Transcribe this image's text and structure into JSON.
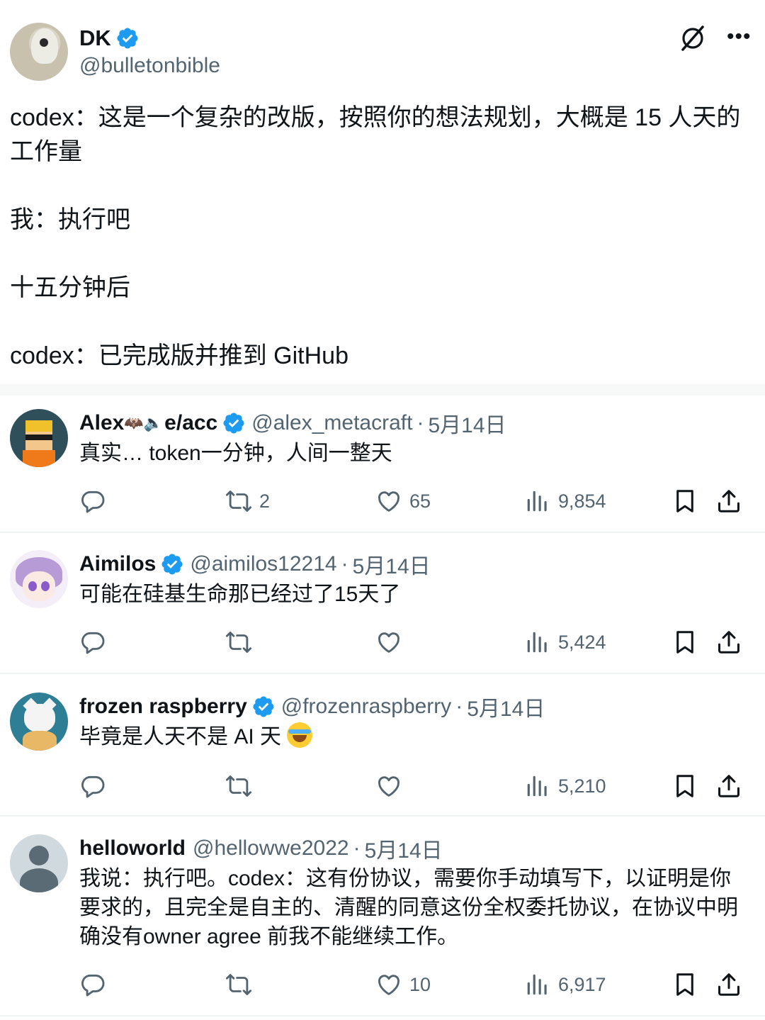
{
  "post": {
    "author_name": "DK",
    "author_handle": "@bulletonbible",
    "paragraphs": [
      "codex：这是一个复杂的改版，按照你的想法规划，大概是 15 人天的工作量",
      "我：执行吧",
      "十五分钟后",
      "codex：已完成版并推到 GitHub"
    ]
  },
  "replies": [
    {
      "name": "Alex",
      "name_suffix": "e/acc",
      "name_emoji": "🦇🔈",
      "verified": true,
      "handle": "@alex_metacraft",
      "date": "5月14日",
      "text": "真实… token一分钟，人间一整天",
      "reposts": "2",
      "likes": "65",
      "views": "9,854"
    },
    {
      "name": "Aimilos",
      "verified": true,
      "handle": "@aimilos12214",
      "date": "5月14日",
      "text": "可能在硅基生命那已经过了15天了",
      "reposts": "",
      "likes": "",
      "views": "5,424"
    },
    {
      "name": "frozen raspberry",
      "verified": true,
      "handle": "@frozenraspberry",
      "date": "5月14日",
      "text": "毕竟是人天不是 AI 天",
      "emoji": "face-with-tears-of-joy",
      "reposts": "",
      "likes": "",
      "views": "5,210"
    },
    {
      "name": "helloworld",
      "verified": false,
      "handle": "@hellowwe2022",
      "date": "5月14日",
      "text": "我说：执行吧。codex：这有份协议，需要你手动填写下，以证明是你要求的，且完全是自主的、清醒的同意这份全权委托协议，在协议中明确没有owner agree 前我不能继续工作。",
      "reposts": "",
      "likes": "10",
      "views": "6,917"
    }
  ],
  "separator_dot": "·",
  "colors": {
    "text": "#0f1419",
    "secondary": "#536471",
    "verified": "#1d9bf0",
    "divider": "#eff3f4"
  }
}
